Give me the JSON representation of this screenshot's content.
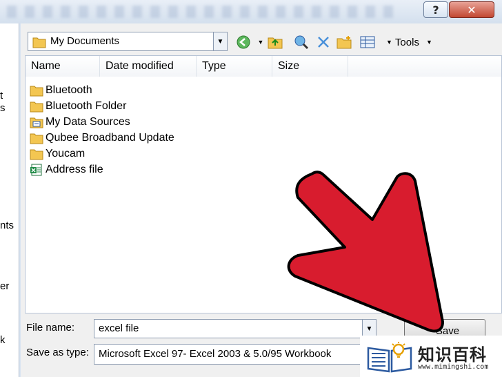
{
  "titlebar": {
    "help_label": "?",
    "close_label": "✕"
  },
  "left_nav_fragments": [
    "t",
    "s",
    "nts",
    "er",
    "k"
  ],
  "toolbar": {
    "look_in_value": "My Documents",
    "tools_label": "Tools",
    "icons": [
      "back-icon",
      "up-folder-icon",
      "search-web-icon",
      "delete-icon",
      "new-folder-icon",
      "views-icon"
    ]
  },
  "list": {
    "columns": [
      "Name",
      "Date modified",
      "Type",
      "Size"
    ],
    "items": [
      {
        "name": "Bluetooth",
        "icon": "folder-icon"
      },
      {
        "name": "Bluetooth Folder",
        "icon": "folder-icon"
      },
      {
        "name": "My Data Sources",
        "icon": "data-source-folder-icon"
      },
      {
        "name": "Qubee Broadband Update",
        "icon": "folder-icon"
      },
      {
        "name": "Youcam",
        "icon": "folder-icon"
      },
      {
        "name": "Address file",
        "icon": "excel-file-icon"
      }
    ]
  },
  "form": {
    "file_name_label": "File name:",
    "file_name_value": "excel file",
    "save_as_type_label": "Save as type:",
    "save_as_type_value": "Microsoft Excel 97- Excel 2003 & 5.0/95 Workbook",
    "save_label": "Save"
  },
  "watermark": {
    "title": "知识百科",
    "url": "www.mimingshi.com"
  },
  "colors": {
    "arrow": "#d81c2e",
    "accent": "#2c5aa0"
  }
}
